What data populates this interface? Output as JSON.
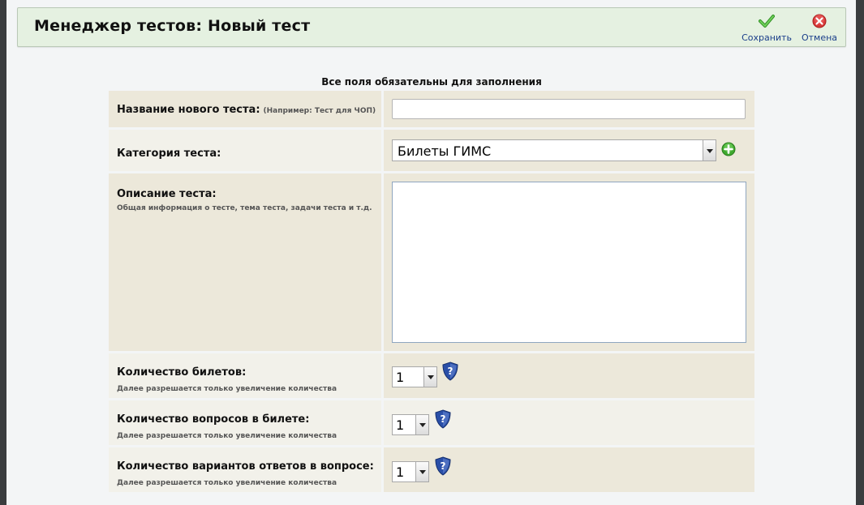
{
  "header": {
    "title": "Менеджер тестов: Новый тест",
    "save_label": "Сохранить",
    "cancel_label": "Отмена",
    "save_icon": "checkmark-icon",
    "cancel_icon": "close-icon",
    "save_color": "#3aa52b",
    "cancel_color": "#d93a3a"
  },
  "form": {
    "required_note": "Все поля обязательны для заполнения",
    "test_name": {
      "label": "Название нового теста:",
      "hint": "(Например: Тест для ЧОП)",
      "value": ""
    },
    "category": {
      "label": "Категория теста:",
      "selected": "Билеты ГИМС",
      "add_icon": "add-plus-icon"
    },
    "description": {
      "label": "Описание теста:",
      "hint": "Общая информация о тесте, тема теста, задачи теста и т.д.",
      "value": ""
    },
    "tickets_count": {
      "label": "Количество билетов:",
      "hint": "Далее разрешается только увеличение количества",
      "selected": "1"
    },
    "questions_count": {
      "label": "Количество вопросов в билете:",
      "hint": "Далее разрешается только увеличение количества",
      "selected": "1"
    },
    "answers_count": {
      "label": "Количество вариантов ответов в вопросе:",
      "hint": "Далее разрешается только увеличение количества",
      "selected": "1"
    }
  }
}
